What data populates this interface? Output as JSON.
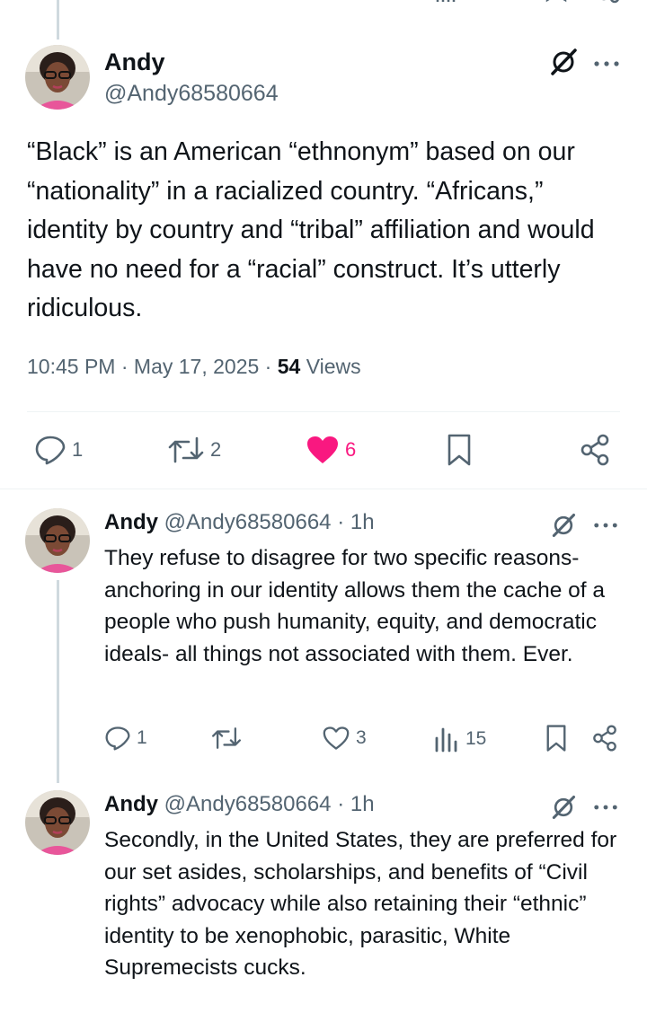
{
  "main_tweet": {
    "author_name": "Andy",
    "handle": "@Andy68580664",
    "text": "“Black” is an American “ethnonym”  based on our “nationality” in a racialized country. “Africans,” identity by country and “tribal” affiliation and would have no need for a “racial” construct. It’s utterly ridiculous.",
    "time": "10:45 PM",
    "date": "May 17, 2025",
    "views_count": "54",
    "views_label": "Views",
    "separator": "·",
    "actions": {
      "replies": "1",
      "reposts": "2",
      "likes": "6"
    }
  },
  "replies": [
    {
      "author_name": "Andy",
      "handle": "@Andy68580664",
      "time": "1h",
      "separator": "·",
      "text": "They refuse to disagree for two specific reasons- anchoring in our identity allows them the cache of a people who push humanity, equity, and democratic ideals- all things not associated with them. Ever.",
      "actions": {
        "replies": "1",
        "reposts": "",
        "likes": "3",
        "views": "15"
      }
    },
    {
      "author_name": "Andy",
      "handle": "@Andy68580664",
      "time": "1h",
      "separator": "·",
      "text": "Secondly, in the United States, they are preferred for our set asides, scholarships, and benefits of “Civil rights” advocacy while also retaining their “ethnic” identity to be xenophobic, parasitic, White Supremecists cucks."
    }
  ],
  "colors": {
    "like_pink": "#f91880",
    "muted": "#536471",
    "text": "#0f1419",
    "thread_line": "#cfd9de",
    "divider": "#eff3f4"
  },
  "icons": [
    "reply-icon",
    "repost-icon",
    "like-icon",
    "views-icon",
    "bookmark-icon",
    "share-icon",
    "grok-icon",
    "more-icon"
  ]
}
